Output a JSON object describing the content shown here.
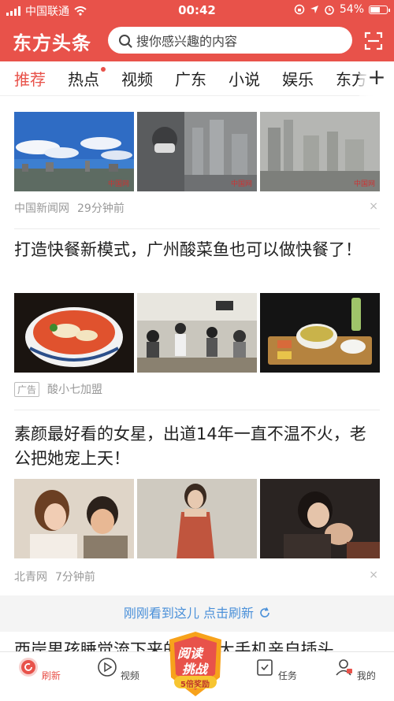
{
  "status_bar": {
    "carrier": "中国联通",
    "time": "00:42",
    "battery": "54%"
  },
  "header": {
    "logo": "东方头条",
    "search_placeholder": "搜你感兴趣的内容"
  },
  "tabs": [
    {
      "label": "推荐",
      "active": true,
      "dot": false
    },
    {
      "label": "热点",
      "active": false,
      "dot": true
    },
    {
      "label": "视频",
      "active": false,
      "dot": false
    },
    {
      "label": "广东",
      "active": false,
      "dot": false
    },
    {
      "label": "小说",
      "active": false,
      "dot": false
    },
    {
      "label": "娱乐",
      "active": false,
      "dot": false
    },
    {
      "label": "东方",
      "active": false,
      "dot": false
    }
  ],
  "tab_add": "+",
  "feed": {
    "item1": {
      "source": "中国新闻网",
      "time": "29分钟前",
      "watermark": "中国网"
    },
    "item2": {
      "title": "打造快餐新模式，广州酸菜鱼也可以做快餐了！",
      "ad_label": "广告",
      "source": "酸小七加盟"
    },
    "item3": {
      "title": "素颜最好看的女星，出道14年一直不温不火，老公把她宠上天！",
      "source": "北青网",
      "time": "7分钟前"
    },
    "item4": {
      "title": "西岸男孩睡觉流下来的口水 大手机亲自插头"
    }
  },
  "close_glyph": "×",
  "refresh": {
    "text": "刚刚看到这儿 点击刷新"
  },
  "promo": {
    "line1": "阅读",
    "line2": "挑战",
    "line3": "5倍奖励"
  },
  "bottom_nav": [
    {
      "label": "刷新",
      "active": true
    },
    {
      "label": "视频",
      "active": false
    },
    {
      "label": "任务",
      "active": false
    },
    {
      "label": "我的",
      "active": false
    }
  ],
  "colors": {
    "brand": "#e8524a",
    "link": "#4a90d9"
  }
}
